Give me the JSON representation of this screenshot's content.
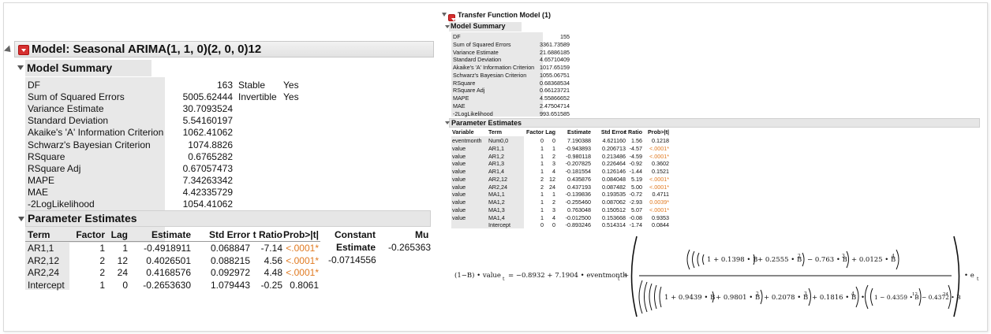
{
  "left": {
    "title": "Model: Seasonal ARIMA(1, 1, 0)(2, 0, 0)12",
    "summary_title": "Model Summary",
    "summary_rows": [
      {
        "label": "DF",
        "value": "163"
      },
      {
        "label": "Sum of Squared Errors",
        "value": "5005.62444"
      },
      {
        "label": "Variance Estimate",
        "value": "30.7093524"
      },
      {
        "label": "Standard Deviation",
        "value": "5.54160197"
      },
      {
        "label": "Akaike's 'A' Information Criterion",
        "value": "1062.41062"
      },
      {
        "label": "Schwarz's Bayesian Criterion",
        "value": "1074.8826"
      },
      {
        "label": "RSquare",
        "value": "0.6765282"
      },
      {
        "label": "RSquare Adj",
        "value": "0.67057473"
      },
      {
        "label": "MAPE",
        "value": "7.34263342"
      },
      {
        "label": "MAE",
        "value": "4.42335729"
      },
      {
        "label": "-2LogLikelihood",
        "value": "1054.41062"
      }
    ],
    "side_rows": [
      {
        "label": "Stable",
        "value": "Yes"
      },
      {
        "label": "Invertible",
        "value": "Yes"
      }
    ],
    "param_title": "Parameter Estimates",
    "param_headers": [
      "Term",
      "Factor",
      "Lag",
      "Estimate",
      "Std Error",
      "t Ratio",
      "Prob>|t|"
    ],
    "param_rows": [
      {
        "term": "AR1,1",
        "factor": "1",
        "lag": "1",
        "estimate": "-0.4918911",
        "stderr": "0.068847",
        "tratio": "-7.14",
        "prob": "<.0001*",
        "sig": true
      },
      {
        "term": "AR2,12",
        "factor": "2",
        "lag": "12",
        "estimate": "0.4026501",
        "stderr": "0.088215",
        "tratio": "4.56",
        "prob": "<.0001*",
        "sig": true
      },
      {
        "term": "AR2,24",
        "factor": "2",
        "lag": "24",
        "estimate": "0.4168576",
        "stderr": "0.092972",
        "tratio": "4.48",
        "prob": "<.0001*",
        "sig": true
      },
      {
        "term": "Intercept",
        "factor": "1",
        "lag": "0",
        "estimate": "-0.2653630",
        "stderr": "1.079443",
        "tratio": "-0.25",
        "prob": "0.8061",
        "sig": false
      }
    ],
    "constant_header": "Constant",
    "constant_sub": "Estimate",
    "constant_value": "-0.0714556",
    "mu_header": "Mu",
    "mu_value": "-0.265363"
  },
  "right": {
    "title": "Transfer Function Model (1)",
    "summary_title": "Model Summary",
    "summary_rows": [
      {
        "label": "DF",
        "value": "155"
      },
      {
        "label": "Sum of Squared Errors",
        "value": "3361.73589"
      },
      {
        "label": "Variance Estimate",
        "value": "21.6886185"
      },
      {
        "label": "Standard Deviation",
        "value": "4.65710409"
      },
      {
        "label": "Akaike's 'A' Information Criterion",
        "value": "1017.65159"
      },
      {
        "label": "Schwarz's Bayesian Criterion",
        "value": "1055.06751"
      },
      {
        "label": "RSquare",
        "value": "0.68368534"
      },
      {
        "label": "RSquare Adj",
        "value": "0.66123721"
      },
      {
        "label": "MAPE",
        "value": "4.55866652"
      },
      {
        "label": "MAE",
        "value": "2.47504714"
      },
      {
        "label": "-2LogLikelihood",
        "value": "993.651585"
      }
    ],
    "param_title": "Parameter Estimates",
    "param_headers": [
      "Variable",
      "Term",
      "Factor",
      "Lag",
      "Estimate",
      "Std Error",
      "t Ratio",
      "Prob>|t|"
    ],
    "param_rows": [
      {
        "variable": "eventmonth",
        "term": "Num0,0",
        "factor": "0",
        "lag": "0",
        "estimate": "7.190388",
        "stderr": "4.621160",
        "tratio": "1.56",
        "prob": "0.1218",
        "sig": false
      },
      {
        "variable": "value",
        "term": "AR1,1",
        "factor": "1",
        "lag": "1",
        "estimate": "-0.943893",
        "stderr": "0.206713",
        "tratio": "-4.57",
        "prob": "<.0001*",
        "sig": true
      },
      {
        "variable": "value",
        "term": "AR1,2",
        "factor": "1",
        "lag": "2",
        "estimate": "-0.980118",
        "stderr": "0.213486",
        "tratio": "-4.59",
        "prob": "<.0001*",
        "sig": true
      },
      {
        "variable": "value",
        "term": "AR1,3",
        "factor": "1",
        "lag": "3",
        "estimate": "-0.207825",
        "stderr": "0.226464",
        "tratio": "-0.92",
        "prob": "0.3602",
        "sig": false
      },
      {
        "variable": "value",
        "term": "AR1,4",
        "factor": "1",
        "lag": "4",
        "estimate": "-0.181554",
        "stderr": "0.126146",
        "tratio": "-1.44",
        "prob": "0.1521",
        "sig": false
      },
      {
        "variable": "value",
        "term": "AR2,12",
        "factor": "2",
        "lag": "12",
        "estimate": "0.435876",
        "stderr": "0.084048",
        "tratio": "5.19",
        "prob": "<.0001*",
        "sig": true
      },
      {
        "variable": "value",
        "term": "AR2,24",
        "factor": "2",
        "lag": "24",
        "estimate": "0.437193",
        "stderr": "0.087482",
        "tratio": "5.00",
        "prob": "<.0001*",
        "sig": true
      },
      {
        "variable": "value",
        "term": "MA1,1",
        "factor": "1",
        "lag": "1",
        "estimate": "-0.139836",
        "stderr": "0.193535",
        "tratio": "-0.72",
        "prob": "0.4711",
        "sig": false
      },
      {
        "variable": "value",
        "term": "MA1,2",
        "factor": "1",
        "lag": "2",
        "estimate": "-0.255460",
        "stderr": "0.087062",
        "tratio": "-2.93",
        "prob": "0.0039*",
        "sig": true
      },
      {
        "variable": "value",
        "term": "MA1,3",
        "factor": "1",
        "lag": "3",
        "estimate": "0.763048",
        "stderr": "0.150512",
        "tratio": "5.07",
        "prob": "<.0001*",
        "sig": true
      },
      {
        "variable": "value",
        "term": "MA1,4",
        "factor": "1",
        "lag": "4",
        "estimate": "-0.012500",
        "stderr": "0.153668",
        "tratio": "-0.08",
        "prob": "0.9353",
        "sig": false
      },
      {
        "variable": "",
        "term": "Intercept",
        "factor": "0",
        "lag": "0",
        "estimate": "-0.893246",
        "stderr": "0.514314",
        "tratio": "-1.74",
        "prob": "0.0844",
        "sig": false
      }
    ],
    "equation": {
      "lhs": "(1−B) • value",
      "lhs_sub": "t",
      "mid": "= −0.8932 + 7.1904 • eventmonth",
      "mid_sub": "t",
      "plus": "+",
      "num_a": "1 + 0.1398 • B",
      "num_b": "+ 0.2555 • B",
      "num_b_exp": "2",
      "num_c": "− 0.763 • B",
      "num_c_exp": "3",
      "num_d": "+ 0.0125 • B",
      "num_d_exp": "4",
      "den_a": "1 + 0.9439 • B",
      "den_b": "+ 0.9801 • B",
      "den_b_exp": "2",
      "den_c": "+ 0.2078 • B",
      "den_c_exp": "3",
      "den_d": "+ 0.1816 • B",
      "den_d_exp": "4",
      "dot": "•",
      "den_e": "1 − 0.4359 • B",
      "den_e_exp": "12",
      "den_f": "− 0.4372 • B",
      "den_f_exp": "24",
      "rhs": "• e",
      "rhs_sub": "t"
    }
  },
  "colors": {
    "significant": "#e07a22",
    "hotspot": "#d63030",
    "header_bg": "#e6e6e6"
  }
}
